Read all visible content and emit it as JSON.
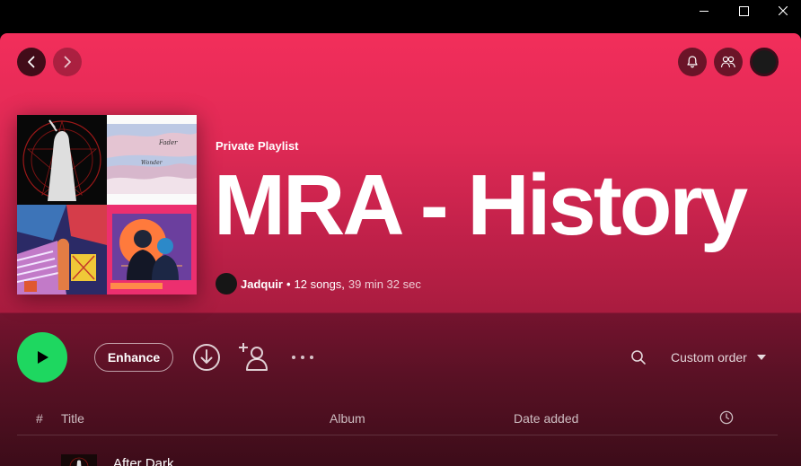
{
  "app": {
    "accent_color": "#1ed760",
    "header_color": "#f22e5b"
  },
  "window_controls": {
    "minimize_icon": "minimize-icon",
    "maximize_icon": "maximize-icon",
    "close_icon": "close-icon"
  },
  "nav": {
    "back_icon": "chevron-left-icon",
    "forward_icon": "chevron-right-icon"
  },
  "top_right": {
    "icons": [
      "bell-icon",
      "friends-icon",
      "avatar"
    ]
  },
  "playlist": {
    "type_label": "Private Playlist",
    "title": "MRA - History",
    "owner": "Jadquir",
    "separator": "•",
    "song_count": "12 songs,",
    "duration": "39 min 32 sec"
  },
  "actions": {
    "enhance_label": "Enhance",
    "sort_label": "Custom order",
    "icons": [
      "play-icon",
      "download-icon",
      "add-user-icon",
      "more-icon",
      "search-icon",
      "caret-down-icon"
    ]
  },
  "columns": {
    "num": "#",
    "title": "Title",
    "album": "Album",
    "date_added": "Date added",
    "duration_icon": "clock-icon"
  },
  "tracks": [
    {
      "title": "After Dark"
    }
  ]
}
